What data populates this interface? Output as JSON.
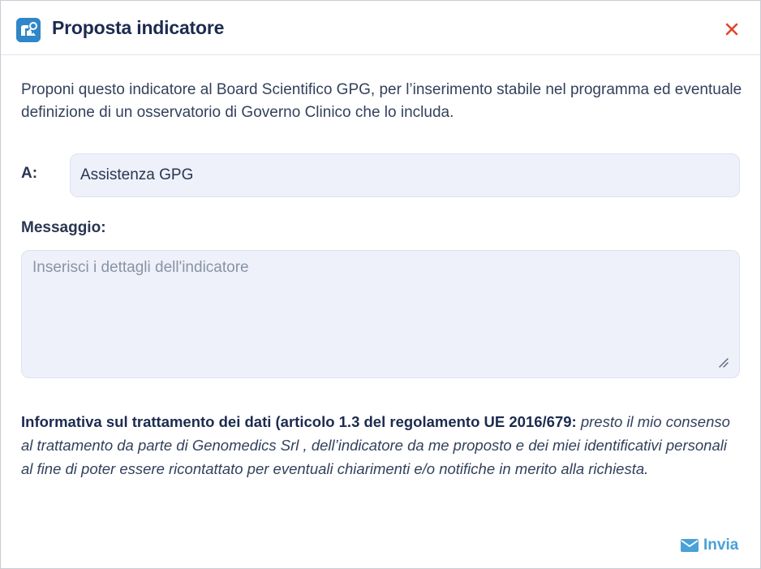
{
  "dialog": {
    "title": "Proposta indicatore",
    "app_icon": "app-logo-icon",
    "close_icon": "close-icon",
    "intro_text": "Proponi questo indicatore al Board Scientifico GPG, per l’inserimento stabile nel programma ed eventuale definizione di un osservatorio di Governo Clinico che lo includa.",
    "to_label": "A:",
    "to_value": "Assistenza GPG",
    "message_label": "Messaggio:",
    "message_placeholder": "Inserisci i dettagli dell'indicatore",
    "message_value": "",
    "privacy_bold": "Informativa sul trattamento dei dati (articolo 1.3 del regolamento UE 2016/679:",
    "privacy_italic": "presto il mio consenso al trattamento da parte di Genomedics Srl , dell’indicatore da me proposto e dei miei identificativi personali al fine di poter essere ricontattato per eventuali chiarimenti e/o notifiche in merito alla richiesta.",
    "send_label": "Invia",
    "send_icon": "envelope-icon"
  },
  "colors": {
    "title": "#1c2b4f",
    "close": "#e0452f",
    "accent": "#4aa0d8",
    "field_bg": "#eef1fa",
    "icon_bg": "#2f86c8"
  }
}
